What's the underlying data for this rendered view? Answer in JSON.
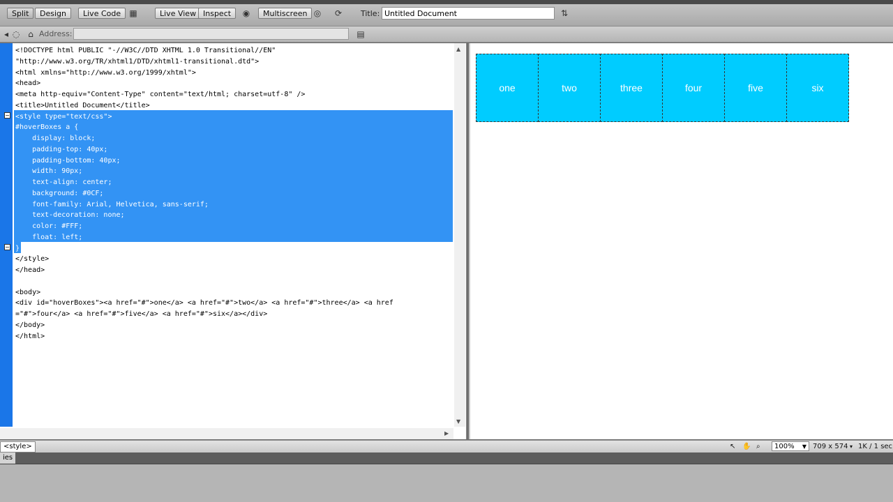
{
  "toolbar": {
    "split_label": "Split",
    "design_label": "Design",
    "live_code_label": "Live Code",
    "live_view_label": "Live View",
    "inspect_label": "Inspect",
    "multiscreen_label": "Multiscreen",
    "title_label": "Title:",
    "title_value": "Untitled Document"
  },
  "address": {
    "label": "Address:",
    "value": ""
  },
  "code": {
    "lines": [
      "<!DOCTYPE html PUBLIC \"-//W3C//DTD XHTML 1.0 Transitional//EN\"",
      "\"http://www.w3.org/TR/xhtml1/DTD/xhtml1-transitional.dtd\">",
      "<html xmlns=\"http://www.w3.org/1999/xhtml\">",
      "<head>",
      "<meta http-equiv=\"Content-Type\" content=\"text/html; charset=utf-8\" />",
      "<title>Untitled Document</title>",
      "<style type=\"text/css\">",
      "#hoverBoxes a {",
      "    display: block;",
      "    padding-top: 40px;",
      "    padding-bottom: 40px;",
      "    width: 90px;",
      "    text-align: center;",
      "    background: #0CF;",
      "    font-family: Arial, Helvetica, sans-serif;",
      "    text-decoration: none;",
      "    color: #FFF;",
      "    float: left;",
      "}",
      "</style>",
      "</head>",
      "",
      "<body>",
      "<div id=\"hoverBoxes\"><a href=\"#\">one</a> <a href=\"#\">two</a> <a href=\"#\">three</a> <a href",
      "=\"#\">four</a> <a href=\"#\">five</a> <a href=\"#\">six</a></div>",
      "</body>",
      "</html>"
    ]
  },
  "design": {
    "boxes": [
      "one",
      "two",
      "three",
      "four",
      "five",
      "six"
    ],
    "box_color": "#00ccff",
    "text_color": "#ffffff"
  },
  "status": {
    "tag_selector": "<style>",
    "zoom": "100%",
    "dimensions": "709 x 574",
    "file_info": "1K / 1 sec"
  },
  "panel": {
    "tab_label": "ies"
  },
  "colors": {
    "selection": "#3393f4",
    "gutter": "#1a76e8"
  }
}
